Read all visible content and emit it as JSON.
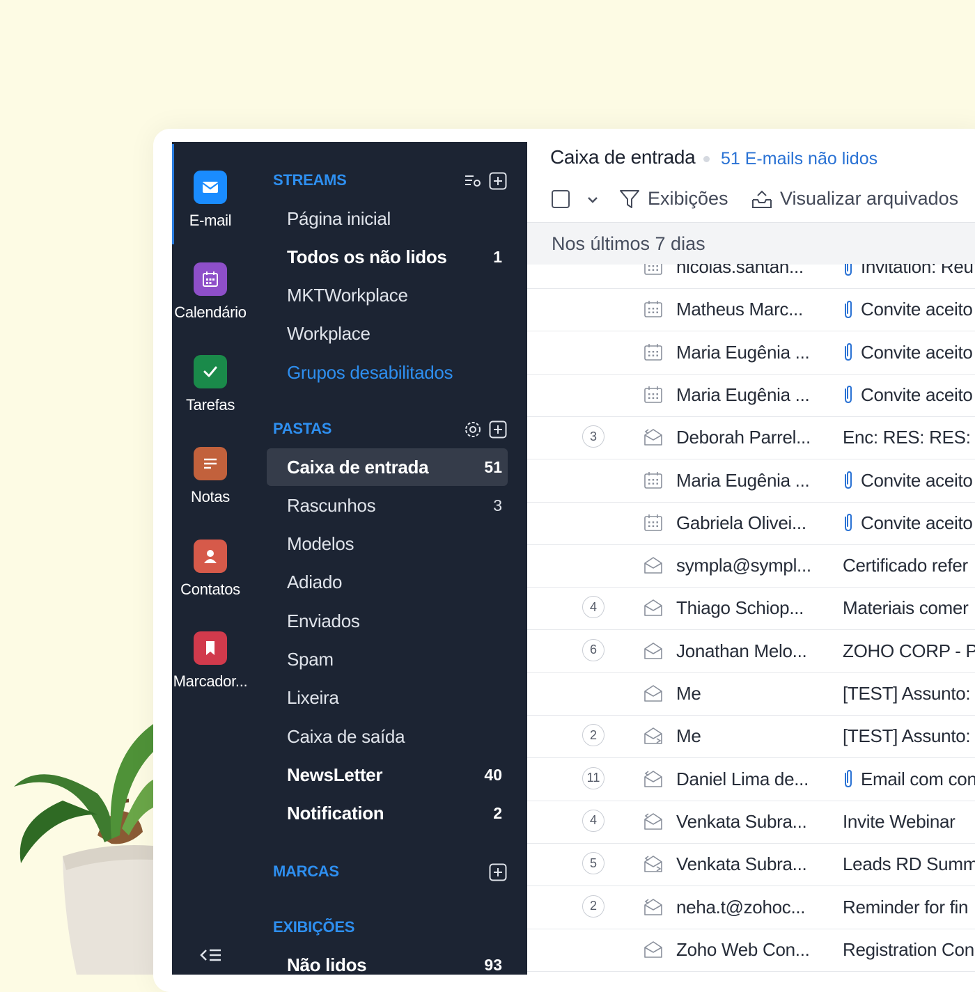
{
  "colors": {
    "background": "#fdfbe4",
    "sidebar": "#1c2433",
    "accent": "#2e8ff0",
    "selected_item": "#353c4a",
    "link": "#2a72d4"
  },
  "rail": {
    "items": [
      {
        "label": "E-mail",
        "icon": "mail-icon",
        "color": "#1a8cff",
        "active": true
      },
      {
        "label": "Calendário",
        "icon": "calendar-icon",
        "color": "#8e4fc9",
        "active": false
      },
      {
        "label": "Tarefas",
        "icon": "check-icon",
        "color": "#1a8a4a",
        "active": false
      },
      {
        "label": "Notas",
        "icon": "notes-icon",
        "color": "#c2613c",
        "active": false
      },
      {
        "label": "Contatos",
        "icon": "contact-icon",
        "color": "#d65a4a",
        "active": false
      },
      {
        "label": "Marcador...",
        "icon": "bookmark-icon",
        "color": "#d13a4c",
        "active": false
      }
    ]
  },
  "panel": {
    "streams": {
      "title": "STREAMS",
      "items": [
        {
          "label": "Página inicial",
          "count": "",
          "style": "normal"
        },
        {
          "label": "Todos os não lidos",
          "count": "1",
          "style": "bold"
        },
        {
          "label": "MKTWorkplace",
          "count": "",
          "style": "normal"
        },
        {
          "label": "Workplace",
          "count": "",
          "style": "normal"
        },
        {
          "label": "Grupos desabilitados",
          "count": "",
          "style": "link"
        }
      ]
    },
    "folders": {
      "title": "PASTAS",
      "items": [
        {
          "label": "Caixa de entrada",
          "count": "51",
          "style": "selected"
        },
        {
          "label": "Rascunhos",
          "count": "3",
          "style": "normal"
        },
        {
          "label": "Modelos",
          "count": "",
          "style": "normal"
        },
        {
          "label": "Adiado",
          "count": "",
          "style": "normal"
        },
        {
          "label": "Enviados",
          "count": "",
          "style": "normal"
        },
        {
          "label": "Spam",
          "count": "",
          "style": "normal"
        },
        {
          "label": "Lixeira",
          "count": "",
          "style": "normal"
        },
        {
          "label": "Caixa de saída",
          "count": "",
          "style": "normal"
        },
        {
          "label": "NewsLetter",
          "count": "40",
          "style": "bold"
        },
        {
          "label": "Notification",
          "count": "2",
          "style": "bold"
        }
      ]
    },
    "tags": {
      "title": "MARCAS"
    },
    "views": {
      "title": "EXIBIÇÕES",
      "items": [
        {
          "label": "Não lidos",
          "count": "93",
          "style": "bold"
        }
      ]
    }
  },
  "main": {
    "title": "Caixa de entrada",
    "unread": "51 E-mails não lidos",
    "toolbar": {
      "views_label": "Exibições",
      "archived_label": "Visualizar arquivados"
    },
    "group_header": "Nos últimos 7 dias",
    "mails": [
      {
        "count": "",
        "icon": "calendar-invite-icon",
        "sender": "nicolas.santan...",
        "subject": "Invitation: Reu",
        "attachment": true
      },
      {
        "count": "",
        "icon": "calendar-invite-icon",
        "sender": "Matheus Marc...",
        "subject": "Convite aceito",
        "attachment": true
      },
      {
        "count": "",
        "icon": "calendar-invite-icon",
        "sender": "Maria Eugênia ...",
        "subject": "Convite aceito",
        "attachment": true
      },
      {
        "count": "",
        "icon": "calendar-invite-icon",
        "sender": "Maria Eugênia ...",
        "subject": "Convite aceito",
        "attachment": true
      },
      {
        "count": "3",
        "icon": "replied-icon",
        "sender": "Deborah Parrel...",
        "subject": "Enc: RES: RES: R",
        "attachment": false
      },
      {
        "count": "",
        "icon": "calendar-invite-icon",
        "sender": "Maria Eugênia ...",
        "subject": "Convite aceito",
        "attachment": true
      },
      {
        "count": "",
        "icon": "calendar-invite-icon",
        "sender": "Gabriela Olivei...",
        "subject": "Convite aceito",
        "attachment": true
      },
      {
        "count": "",
        "icon": "envelope-open-icon",
        "sender": "sympla@sympl...",
        "subject": "Certificado refer",
        "attachment": false
      },
      {
        "count": "4",
        "icon": "envelope-open-icon",
        "sender": "Thiago Schiop...",
        "subject": "Materiais comer",
        "attachment": false
      },
      {
        "count": "6",
        "icon": "envelope-open-icon",
        "sender": "Jonathan Melo...",
        "subject": "ZOHO CORP - P",
        "attachment": false
      },
      {
        "count": "",
        "icon": "envelope-open-icon",
        "sender": "Me",
        "subject": "[TEST] Assunto:",
        "attachment": false
      },
      {
        "count": "2",
        "icon": "forwarded-icon",
        "sender": "Me",
        "subject": "[TEST] Assunto:",
        "attachment": false
      },
      {
        "count": "11",
        "icon": "replied-icon",
        "sender": "Daniel Lima de...",
        "subject": "Email com con",
        "attachment": true
      },
      {
        "count": "4",
        "icon": "replied-icon",
        "sender": "Venkata Subra...",
        "subject": "Invite Webinar",
        "attachment": false
      },
      {
        "count": "5",
        "icon": "reply-forward-icon",
        "sender": "Venkata Subra...",
        "subject": "Leads RD Summ",
        "attachment": false
      },
      {
        "count": "2",
        "icon": "replied-icon",
        "sender": "neha.t@zohoc...",
        "subject": "Reminder for fin",
        "attachment": false
      },
      {
        "count": "",
        "icon": "envelope-open-icon",
        "sender": "Zoho Web Con...",
        "subject": "Registration Con",
        "attachment": false
      }
    ]
  }
}
